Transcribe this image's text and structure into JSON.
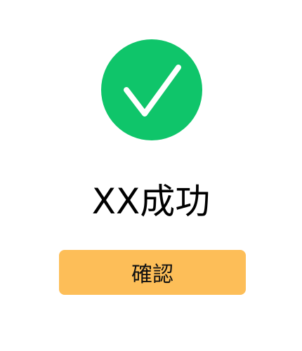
{
  "dialog": {
    "icon": "checkmark-circle-icon",
    "title": "XX成功",
    "confirm_label": "確認"
  },
  "colors": {
    "success_green": "#0FC56A",
    "check_white": "#FFFFFF",
    "button_bg": "#FDBE58",
    "text": "#000000"
  }
}
